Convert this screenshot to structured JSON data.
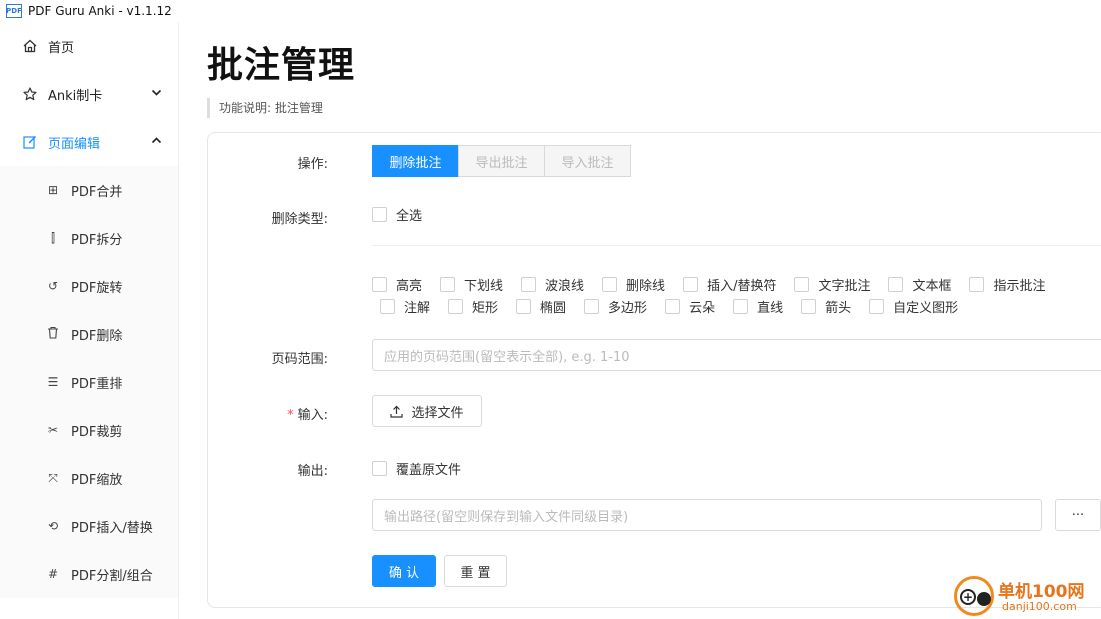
{
  "window": {
    "icon_text": "PDF",
    "title": "PDF Guru Anki - v1.1.12"
  },
  "sidebar": {
    "items": [
      {
        "label": "首页",
        "icon": "home-icon"
      },
      {
        "label": "Anki制卡",
        "icon": "star-icon",
        "chevron": "down"
      },
      {
        "label": "页面编辑",
        "icon": "edit-icon",
        "chevron": "up",
        "active": true
      }
    ],
    "subitems": [
      {
        "label": "PDF合并",
        "icon": "merge-icon"
      },
      {
        "label": "PDF拆分",
        "icon": "split-icon"
      },
      {
        "label": "PDF旋转",
        "icon": "rotate-icon"
      },
      {
        "label": "PDF删除",
        "icon": "trash-icon"
      },
      {
        "label": "PDF重排",
        "icon": "list-icon"
      },
      {
        "label": "PDF裁剪",
        "icon": "scissors-icon"
      },
      {
        "label": "PDF缩放",
        "icon": "scale-icon"
      },
      {
        "label": "PDF插入/替换",
        "icon": "insert-icon"
      },
      {
        "label": "PDF分割/组合",
        "icon": "grid-icon"
      }
    ]
  },
  "main": {
    "title": "批注管理",
    "description": "功能说明: 批注管理",
    "form": {
      "operation_label": "操作:",
      "operations": [
        "删除批注",
        "导出批注",
        "导入批注"
      ],
      "delete_type_label": "删除类型:",
      "select_all": "全选",
      "types_row1": [
        "高亮",
        "下划线",
        "波浪线",
        "删除线",
        "插入/替换符",
        "文字批注",
        "文本框",
        "指示批注"
      ],
      "types_row2": [
        "注解",
        "矩形",
        "椭圆",
        "多边形",
        "云朵",
        "直线",
        "箭头",
        "自定义图形"
      ],
      "page_range_label": "页码范围:",
      "page_range_placeholder": "应用的页码范围(留空表示全部), e.g. 1-10",
      "input_required_mark": "*",
      "input_label": "输入:",
      "select_file_button": "选择文件",
      "output_label": "输出:",
      "overwrite_label": "覆盖原文件",
      "output_placeholder": "输出路径(留空则保存到输入文件同级目录)",
      "browse_button": "···",
      "confirm_button": "确 认",
      "reset_button": "重 置"
    }
  },
  "watermark": {
    "name": "单机100网",
    "url": "danji100.com"
  },
  "colors": {
    "accent": "#1890ff",
    "required": "#ff4d4f",
    "watermark": "#e8741a"
  }
}
